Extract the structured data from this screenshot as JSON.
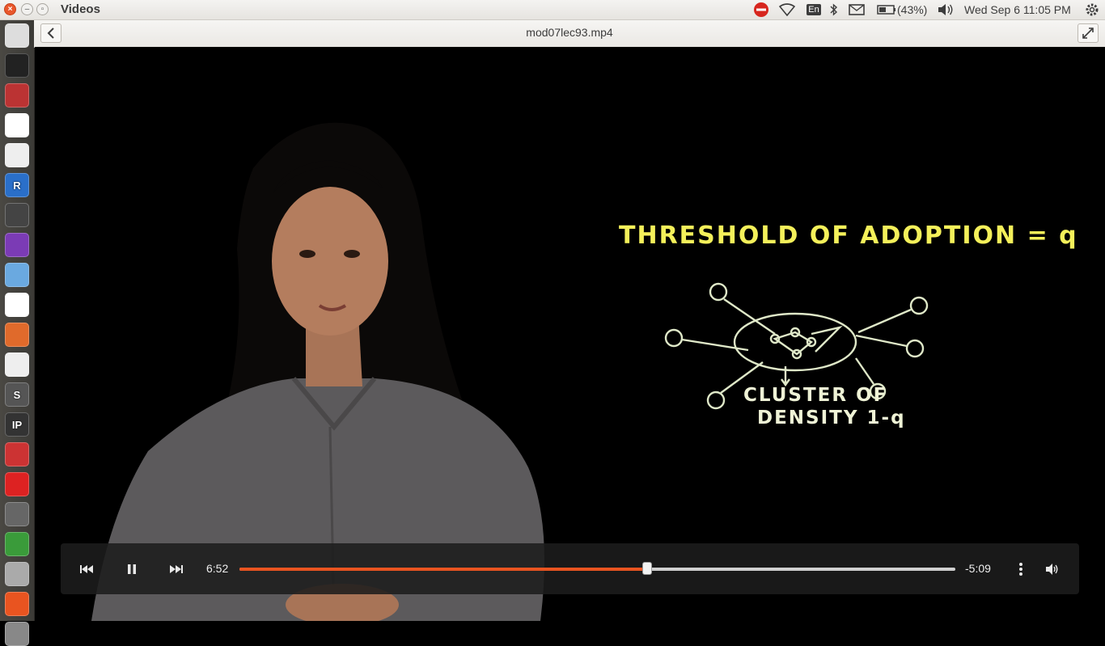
{
  "window": {
    "app_title": "Videos"
  },
  "tray": {
    "keyboard_layout": "En",
    "battery_percent": "(43%)",
    "clock": "Wed Sep  6 11:05 PM"
  },
  "header": {
    "file_title": "mod07lec93.mp4"
  },
  "launcher": {
    "items": [
      {
        "icon": "dash-home-icon"
      },
      {
        "icon": "terminal-icon"
      },
      {
        "icon": "archive-manager-icon"
      },
      {
        "icon": "chrome-icon"
      },
      {
        "icon": "document-viewer-icon"
      },
      {
        "icon": "r-icon",
        "label": "R"
      },
      {
        "icon": "video-clapper-icon"
      },
      {
        "icon": "media-player-icon"
      },
      {
        "icon": "text-document-icon"
      },
      {
        "icon": "gmail-icon"
      },
      {
        "icon": "presentation-icon"
      },
      {
        "icon": "text-editor-icon"
      },
      {
        "icon": "sublime-text-icon",
        "label": "S"
      },
      {
        "icon": "ipython-icon",
        "label": "IP"
      },
      {
        "icon": "network-tool-icon"
      },
      {
        "icon": "opera-icon"
      },
      {
        "icon": "gephi-icon"
      },
      {
        "icon": "spreadsheet-icon"
      },
      {
        "icon": "drive-icon"
      },
      {
        "icon": "software-center-icon"
      },
      {
        "icon": "trash-icon"
      }
    ]
  },
  "video_frame": {
    "board_heading": "THRESHOLD OF ADOPTION = q",
    "board_caption_line1": "CLUSTER OF",
    "board_caption_line2": "DENSITY 1-q"
  },
  "player": {
    "elapsed": "6:52",
    "remaining": "-5:09",
    "progress": 0.57,
    "accent_color": "#e95420"
  }
}
